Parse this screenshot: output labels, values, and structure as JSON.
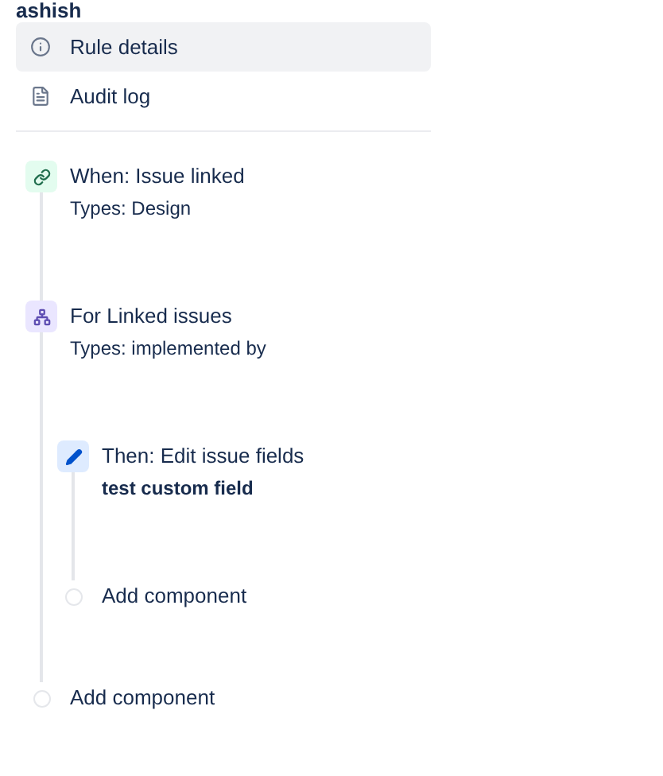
{
  "user": "ashish",
  "nav": [
    {
      "label": "Rule details",
      "kind": "info",
      "selected": true
    },
    {
      "label": "Audit log",
      "kind": "log",
      "selected": false
    }
  ],
  "steps": [
    {
      "kind": "trigger",
      "title": "When: Issue linked",
      "subtitle": "Types: Design"
    },
    {
      "kind": "branch",
      "title": "For Linked issues",
      "subtitle": "Types: implemented by",
      "children": [
        {
          "kind": "action",
          "title": "Then: Edit issue fields",
          "detail": "test custom field"
        },
        {
          "kind": "add",
          "title": "Add component"
        }
      ]
    },
    {
      "kind": "add",
      "title": "Add component"
    }
  ]
}
